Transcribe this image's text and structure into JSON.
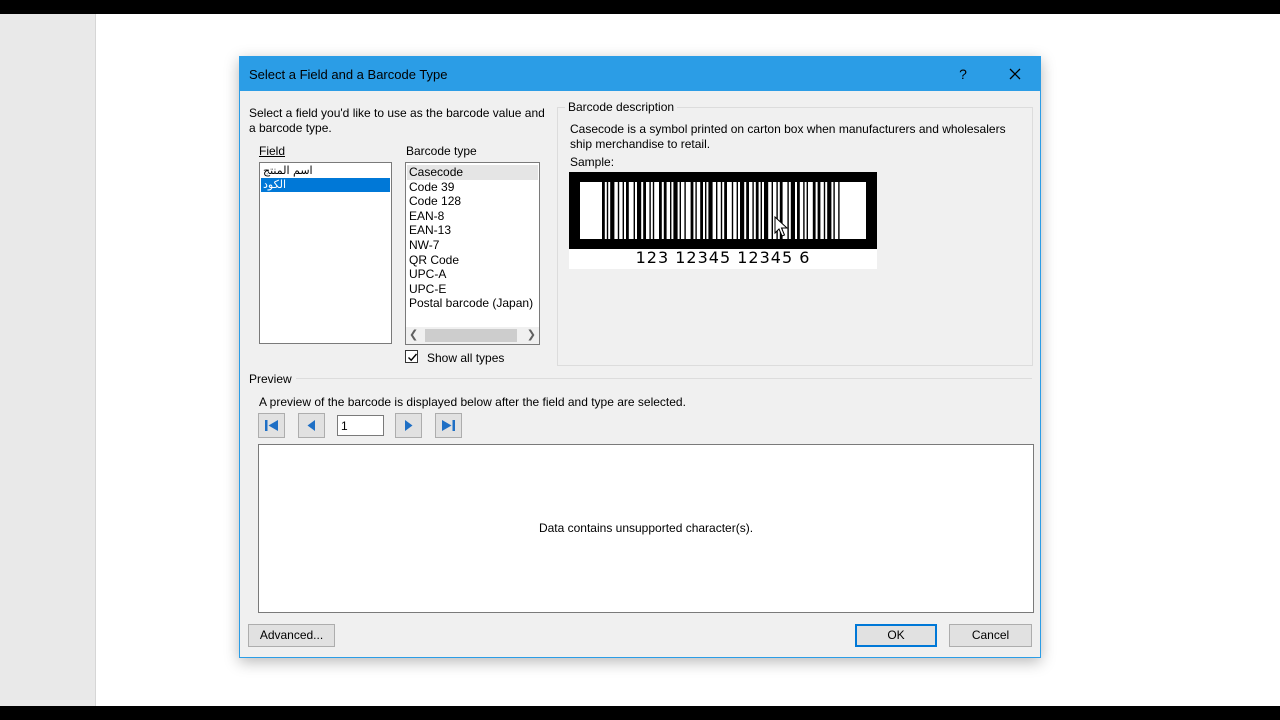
{
  "dialog": {
    "title": "Select a Field and a Barcode Type",
    "help_label": "?",
    "instruction": "Select a field you'd like to use as the barcode value and a barcode type.",
    "field_label": "Field",
    "field_items": [
      "اسم المنتج",
      "الكود"
    ],
    "field_selected_index": 1,
    "barcode_type_label": "Barcode type",
    "barcode_types": [
      "Casecode",
      "Code 39",
      "Code 128",
      "EAN-8",
      "EAN-13",
      "NW-7",
      "QR Code",
      "UPC-A",
      "UPC-E",
      "Postal barcode (Japan)"
    ],
    "barcode_type_selected_index": 0,
    "show_all_types_label": "Show all types",
    "show_all_types_checked": true,
    "description_title": "Barcode description",
    "description_text": "Casecode is a symbol printed on carton box when manufacturers and wholesalers ship merchandise to retail.",
    "sample_label": "Sample:",
    "sample_digits": "123  12345  12345  6",
    "preview_label": "Preview",
    "preview_instruction": "A preview of the barcode is displayed below after the field and type are selected.",
    "record_value": "1",
    "preview_message": "Data contains unsupported character(s).",
    "advanced_label": "Advanced...",
    "ok_label": "OK",
    "cancel_label": "Cancel"
  },
  "colors": {
    "titlebar": "#2b9de6",
    "selection": "#0078d7",
    "nav_icon": "#1e6fc5",
    "dialog_bg": "#f0f0f0"
  },
  "icons": {
    "close": "close-icon",
    "first": "first-record-icon",
    "prev": "previous-record-icon",
    "next": "next-record-icon",
    "last": "last-record-icon",
    "check": "check-icon",
    "cursor": "mouse-pointer-icon"
  }
}
